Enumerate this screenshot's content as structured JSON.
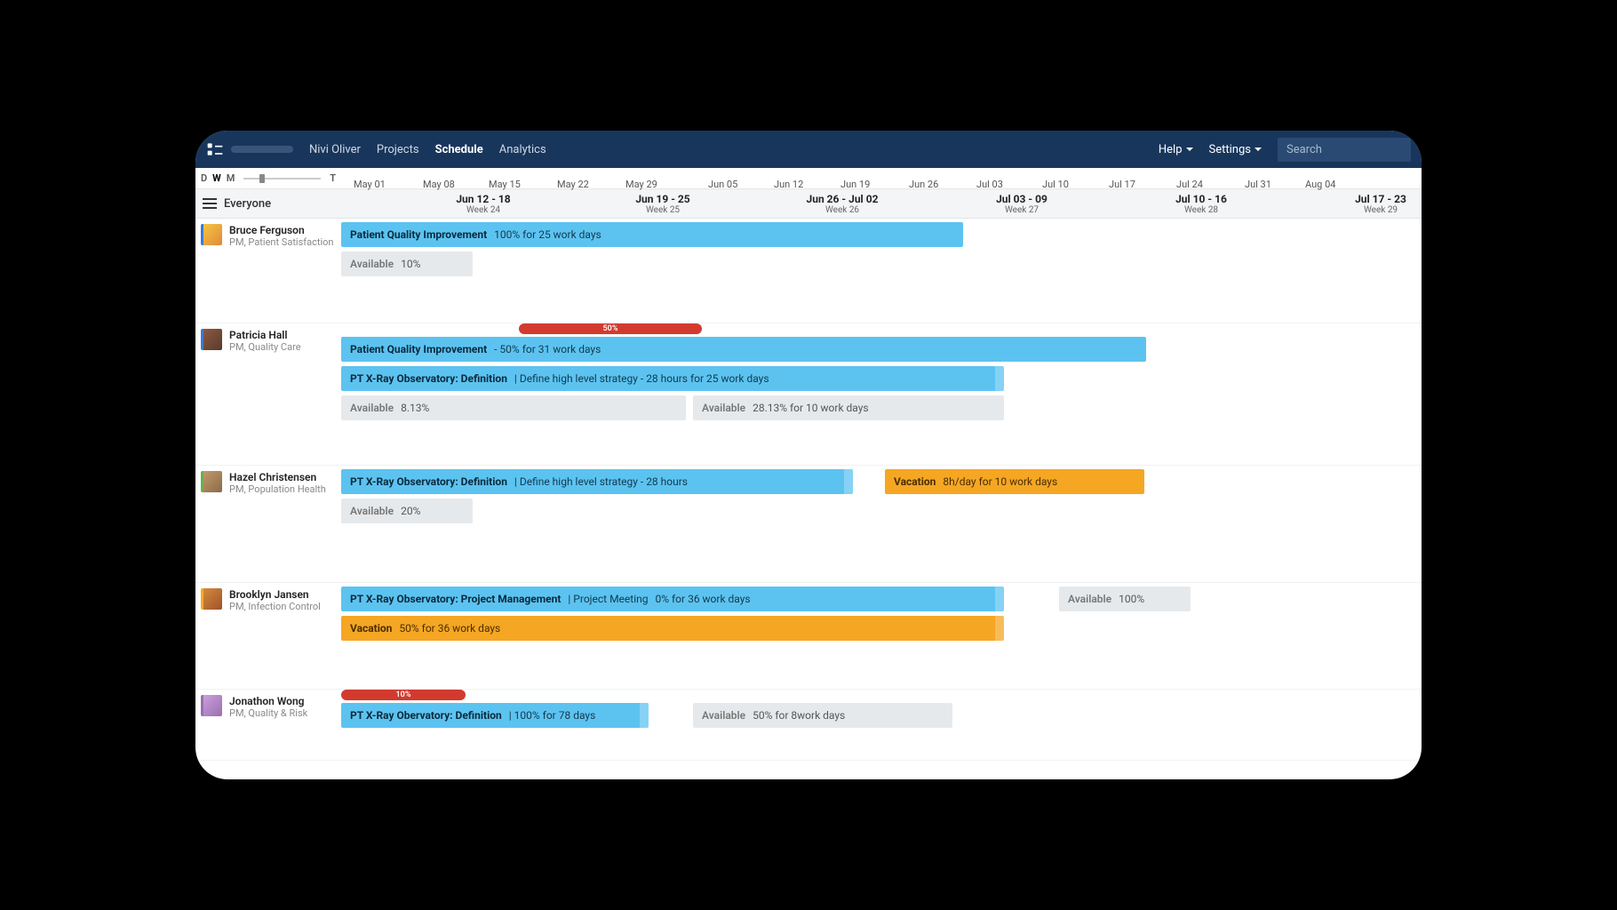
{
  "nav": {
    "user": "Nivi Oliver",
    "projects": "Projects",
    "schedule": "Schedule",
    "analytics": "Analytics",
    "help": "Help",
    "settings": "Settings",
    "search_placeholder": "Search"
  },
  "view_modes": {
    "d": "D",
    "w": "W",
    "m": "M",
    "t": "T"
  },
  "ruler_dates": [
    "May 01",
    "May 08",
    "May 15",
    "May 22",
    "May 29",
    "Jun 05",
    "Jun 12",
    "Jun 19",
    "Jun 26",
    "Jul 03",
    "Jul 10",
    "Jul 17",
    "Jul 24",
    "Jul 31",
    "Aug 04"
  ],
  "weeks": [
    {
      "title": "Jun 12 - 18",
      "sub": "Week 24"
    },
    {
      "title": "Jun 19 - 25",
      "sub": "Week 25"
    },
    {
      "title": "Jun 26 - Jul 02",
      "sub": "Week 26"
    },
    {
      "title": "Jul 03 - 09",
      "sub": "Week 27"
    },
    {
      "title": "Jul 10 - 16",
      "sub": "Week 28"
    },
    {
      "title": "Jul 17 - 23",
      "sub": "Week 29"
    }
  ],
  "everyone": "Everyone",
  "people": {
    "p1": {
      "name": "Bruce Ferguson",
      "role": "PM, Patient Satisfaction"
    },
    "p2": {
      "name": "Patricia Hall",
      "role": "PM, Quality Care"
    },
    "p3": {
      "name": "Hazel Christensen",
      "role": "PM, Population Health"
    },
    "p4": {
      "name": "Brooklyn Jansen",
      "role": "PM, Infection Control"
    },
    "p5": {
      "name": "Jonathon Wong",
      "role": "PM, Quality & Risk"
    }
  },
  "bars": {
    "b1": {
      "title": "Patient Quality Improvement",
      "detail": "100% for 25 work days"
    },
    "b1a": {
      "title": "Available",
      "detail": "10%"
    },
    "b2o": {
      "label": "50%"
    },
    "b2": {
      "title": "Patient Quality Improvement",
      "detail": "- 50% for 31 work days"
    },
    "b3": {
      "title": "PT X-Ray Observatory: Definition",
      "detail": "| Define high level strategy -  28 hours for 25 work days"
    },
    "b3a": {
      "title": "Available",
      "detail": "8.13%"
    },
    "b3b": {
      "title": "Available",
      "detail": "28.13% for 10 work days"
    },
    "b4": {
      "title": "PT X-Ray Observatory: Definition",
      "detail": "| Define high level strategy - 28 hours"
    },
    "b4v": {
      "title": "Vacation",
      "detail": "8h/day for 10 work days"
    },
    "b4a": {
      "title": "Available",
      "detail": "20%"
    },
    "b5": {
      "title": "PT X-Ray Observatory: Project Management",
      "detail1": "| Project Meeting",
      "detail2": "0% for 36 work days"
    },
    "b5v": {
      "title": "Vacation",
      "detail": "50% for 36 work days"
    },
    "b5a": {
      "title": "Available",
      "detail": "100%"
    },
    "b6o": {
      "label": "10%"
    },
    "b6": {
      "title": "PT X-Ray Obervatory: Definition",
      "detail": "| 100% for 78 days"
    },
    "b6a": {
      "title": "Available",
      "detail": "50% for   8work days"
    }
  }
}
